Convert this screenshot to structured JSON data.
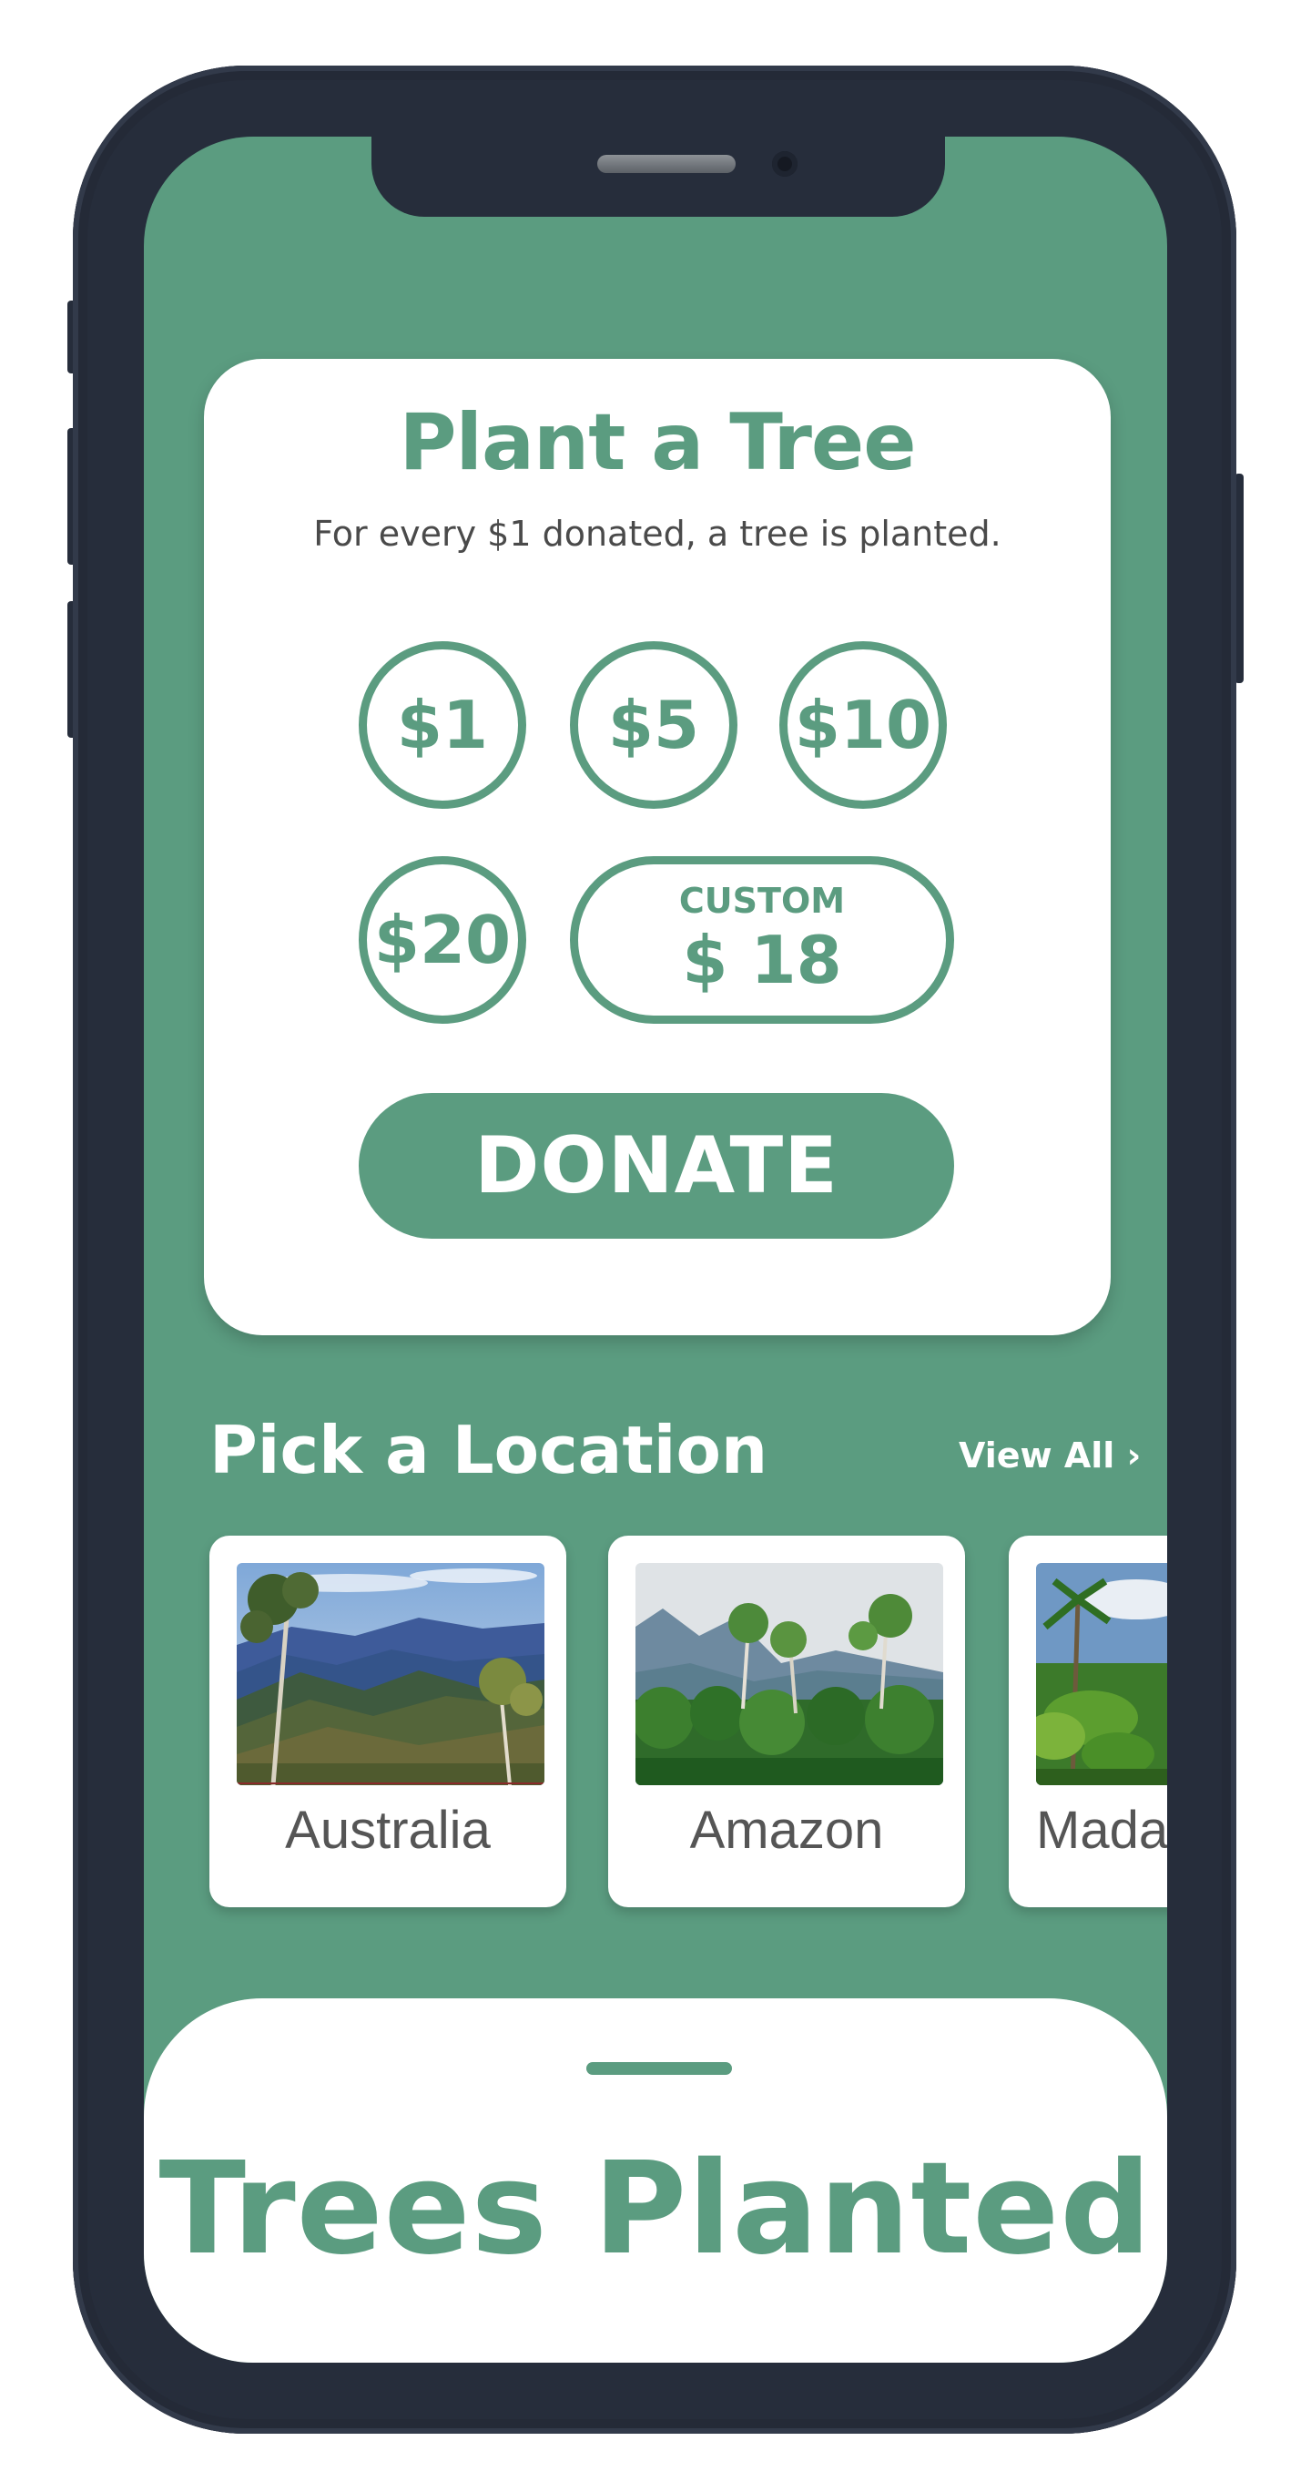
{
  "colors": {
    "accent": "#5b9c80",
    "device_frame": "#262d3b",
    "card_background": "#ffffff",
    "secondary_text": "#4a4a4a"
  },
  "donation": {
    "title": "Plant a Tree",
    "subtitle": "For every $1 donated, a tree is planted.",
    "amounts": [
      "$1",
      "$5",
      "$10",
      "$20"
    ],
    "custom_label": "CUSTOM",
    "custom_value": "$ 18",
    "donate_label": "DONATE"
  },
  "locations": {
    "title": "Pick a Location",
    "view_all": "View All ›",
    "items": [
      {
        "label": "Australia"
      },
      {
        "label": "Amazon"
      },
      {
        "label": "Mada"
      }
    ]
  },
  "sheet": {
    "title": "Trees Planted"
  }
}
